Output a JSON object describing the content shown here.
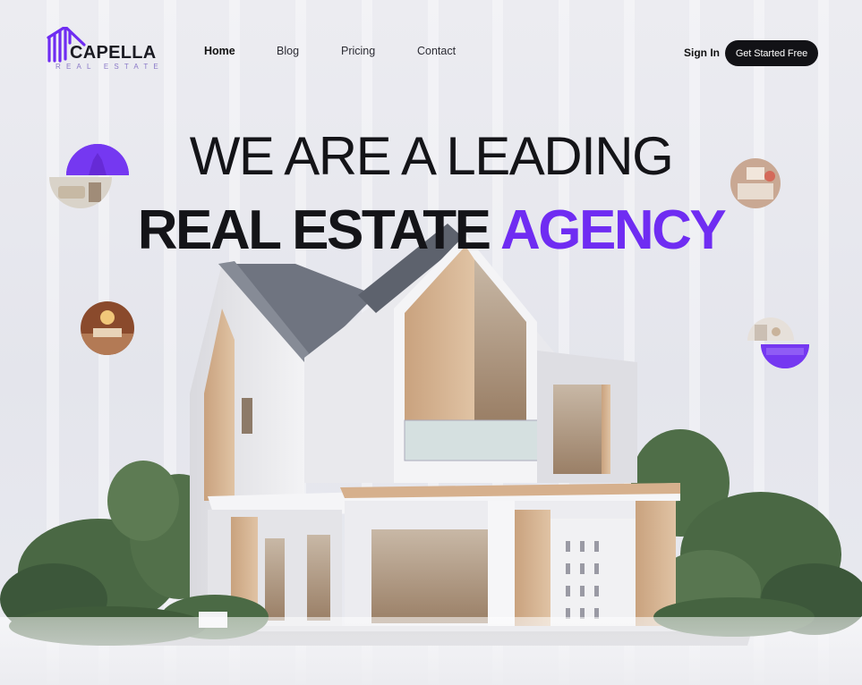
{
  "brand": {
    "name": "CAPELLA",
    "tagline": "REAL ESTATE",
    "accent_color": "#6f2cf2"
  },
  "nav": {
    "items": [
      {
        "label": "Home",
        "active": true
      },
      {
        "label": "Blog",
        "active": false
      },
      {
        "label": "Pricing",
        "active": false
      },
      {
        "label": "Contact",
        "active": false
      }
    ]
  },
  "header": {
    "signin_label": "Sign In",
    "cta_label": "Get Started Free"
  },
  "hero": {
    "line1": "WE ARE A LEADING",
    "line2_part1": "REAL ESTATE",
    "line2_accent": "AGENCY"
  },
  "icons": {
    "logo": "house-stripes-logo-icon"
  }
}
